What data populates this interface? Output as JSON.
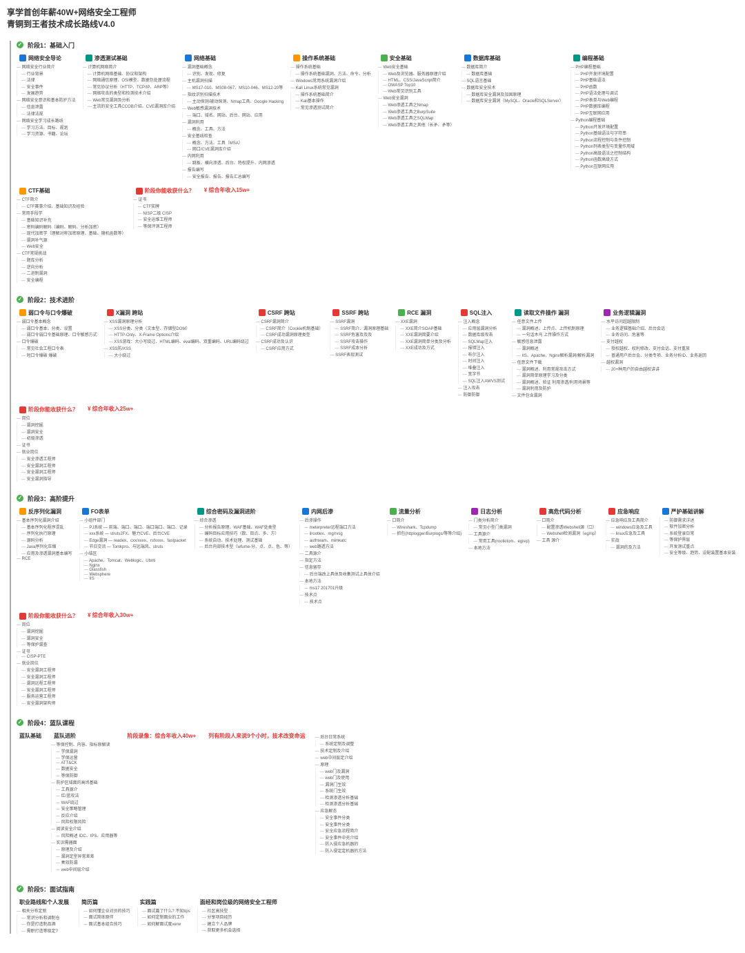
{
  "header": {
    "line1": "享学首创年薪40W+网络安全工程师",
    "line2": "青铜到王者技术成长路线V4.0"
  },
  "stages": [
    {
      "id": "s1",
      "label": "阶段1：基础入门",
      "sections": [
        {
          "icon": "ic-blue",
          "label": "网络安全导论",
          "items": [
            {
              "k": "网络安全行业简介",
              "sub": [
                "行业背景",
                "法律",
                "安全事件",
                "发展趋势"
              ]
            },
            {
              "k": "网络安全意识和基本防护方法",
              "sub": [
                "信息泄露",
                "法律法规"
              ]
            },
            {
              "k": "网络安全学习成长路线",
              "sub": [
                "学习方法、目标、规划",
                "学习资源、书籍、论坛"
              ]
            }
          ]
        },
        {
          "icon": "ic-teal",
          "label": "渗透测试基础",
          "items": [
            {
              "k": "计算机网络简介",
              "sub": [
                "计算机网络基础、协议和架构",
                "网络通信原理、OSI模型、数据包处理流程",
                "常见协议分析（HTTP、TCP/IP、ARP等）",
                "网络攻击的类型和检测技术介绍",
                "Web常见漏洞及分析",
                "主流的安全工具CCOB介绍、CVE漏洞库介绍"
              ]
            }
          ]
        },
        {
          "icon": "ic-blue",
          "label": "网络基础",
          "items": [
            {
              "k": "漏洞基础概念",
              "sub": [
                "识别、发现、修复"
              ]
            },
            {
              "k": "主机漏洞扫描",
              "sub": [
                "MS17-010、MS08-067、MS10-046、MS12-20等"
              ]
            },
            {
              "k": "指纹识别扫描技术",
              "sub": [
                "主动探测/被动探测、Nmap工具、Google Hacking"
              ]
            },
            {
              "k": "Web敏感漏洞技术",
              "sub": [
                "端口、域名、网站、后台、网站、应用"
              ]
            },
            {
              "k": "漏洞利用",
              "sub": [
                "概念、工具、方法"
              ]
            },
            {
              "k": "安全基线检查",
              "sub": [
                "概念、方法、工具（MSA）",
                "网口/CVE漏洞库介绍"
              ]
            },
            {
              "k": "内网利用",
              "sub": [
                "跳板、横向渗透、后台、特权提升、内网渗透"
              ]
            },
            {
              "k": "报告编写",
              "sub": [
                "安全报告、报告、报告汇总编写"
              ]
            }
          ]
        },
        {
          "icon": "ic-orange",
          "label": "操作系统基础",
          "items": [
            {
              "k": "操作系统基础",
              "sub": [
                "操作系统基础漏洞、方法、命令、分析"
              ]
            },
            {
              "k": "Windows常用系统漏洞介绍"
            },
            {
              "k": "Kali Linux系统常见漏洞",
              "sub": [
                "操作系统基础简介",
                "Kali基本操作",
                "常见渗透测试简介"
              ]
            }
          ]
        },
        {
          "icon": "ic-green",
          "label": "安全基础",
          "items": [
            {
              "k": "Web安全基础",
              "sub": [
                "Web及浏览器、服务器原理介绍",
                "HTML、CSS/JavaScript简介",
                "OWASP Top10",
                "Web常见识别工具"
              ]
            },
            {
              "k": "Web安全漏洞",
              "sub": [
                "Web渗透工具之Nmap",
                "Web渗透工具之BurpSuite",
                "Web渗透工具之SQLMap",
                "Web渗透工具之其他（长矛、矛等）"
              ]
            }
          ]
        },
        {
          "icon": "ic-blue",
          "label": "数据库基础",
          "items": [
            {
              "k": "数据库简介",
              "sub": [
                "数据库基础"
              ]
            },
            {
              "k": "SQL语言基础"
            },
            {
              "k": "数据库安全技术",
              "sub": [
                "数据库安全漏洞及加固原理",
                "数据库安全漏洞（MySQL、Oracle和SQLServer）"
              ]
            }
          ]
        },
        {
          "icon": "ic-teal",
          "label": "编程基础",
          "items": [
            {
              "k": "PHP编程基础",
              "sub": [
                "PHP开发环境配置",
                "PHP基础语法",
                "PHP函数",
                "PHP语法处理与调试",
                "PHP表单与Web编程",
                "PHP数据库编程",
                "PHP互联网应用"
              ]
            },
            {
              "k": "Python编程基础",
              "sub": [
                "Python开发环境配置",
                "Python基础语法与字符串",
                "Python流程控制与条件控制",
                "Python列表类型与变量作用域",
                "Python高级语法之控制结构",
                "Python函数高级方式",
                "Python互联网应用"
              ]
            }
          ]
        },
        {
          "icon": "ic-orange",
          "label": "CTF基础",
          "items": [
            {
              "k": "CTF简介",
              "sub": [
                "CTF赛事介绍、基础知识及经验"
              ]
            },
            {
              "k": "常用手段学",
              "sub": [
                "基础知识补充",
                "密码编码解码（编码、解码、分析加密）",
                "现代加密学（理解对称加密原理、基础、随机函数等）",
                "漏洞补气源",
                "Web安全"
              ]
            },
            {
              "k": "CTF常规挑战",
              "sub": [
                "题库分析",
                "逆向分析",
                "二进制漏洞",
                "安全编程"
              ]
            }
          ]
        },
        {
          "icon": "ic-red",
          "label": "阶段你能收获什么？",
          "red": true,
          "items": [
            {
              "k": "证书",
              "sub": [
                "CTF奖牌",
                "NISP二级 CISP",
                "安全运维工程师",
                "等保评测工程师"
              ]
            }
          ]
        },
        {
          "income": "综合年收入15w+"
        }
      ]
    },
    {
      "id": "s2",
      "label": "阶段2：技术进阶",
      "sections": [
        {
          "icon": "ic-orange",
          "label": "弱口令与口令爆破",
          "items": [
            {
              "k": "弱口令基本概念",
              "sub": [
                "弱口令基本、分类、设置",
                "弱口令弱口令基础原理、口令敏感方式"
              ]
            },
            {
              "k": "口令爆破",
              "sub": [
                "常见社会工程口令表",
                "短口令爆破 爆破"
              ]
            }
          ]
        },
        {
          "icon": "ic-red",
          "label": "X漏洞 跨站",
          "items": [
            {
              "k": "XSS漏洞原理分析",
              "sub": [
                "XSS分类、分类（文本型、存储型DOM）",
                "HTTP-Only、X-Frame Options介绍",
                "XSS游戏：大小写绕过、HTML编码、eval编码、双重编码、URL编码绕过"
              ]
            },
            {
              "k": "XSS防/XSS",
              "sub": [
                "大小绕过"
              ]
            }
          ]
        },
        {
          "icon": "ic-red",
          "label": "CSRF 跨站",
          "items": [
            {
              "k": "CSRF漏洞简介",
              "sub": [
                "CSRF简介（Cookie机制基础）",
                "CSRF成功漏洞原理类型"
              ]
            },
            {
              "k": "CSRF成功及认识",
              "sub": [
                "CSRF应用方式"
              ]
            }
          ]
        },
        {
          "icon": "ic-red",
          "label": "SSRF 跨站",
          "items": [
            {
              "k": "SSRF漏洞",
              "sub": [
                "SSRF简介、漏洞原理基础",
                "SSRF危害及及及",
                "SSRF攻击操作",
                "SSRF成本分析"
              ]
            },
            {
              "k": "SSRF表现测试"
            }
          ]
        },
        {
          "icon": "ic-green",
          "label": "RCE 漏洞",
          "items": [
            {
              "k": "XXE漏洞",
              "sub": [
                "XXE简介SOAP基础",
                "XXE漏洞简要介绍",
                "XXE漏洞简单分类及分析",
                "XXE成功及方式"
              ]
            }
          ]
        },
        {
          "icon": "ic-red",
          "label": "SQL注入",
          "items": [
            {
              "k": "注入概念",
              "sub": [
                "应用层漏洞分析",
                "数据库级攻击",
                "SQLMap注入",
                "报错注入",
                "布尔注入",
                "时间注入",
                "堆叠注入",
                "宽字节",
                "SQL注入AWVS测试"
              ]
            },
            {
              "k": "注入攻击"
            },
            {
              "k": "防御防御"
            }
          ]
        },
        {
          "icon": "ic-teal",
          "label": "读取文件操作 漏洞",
          "items": [
            {
              "k": "任意文件上传",
              "sub": [
                "漏洞概述、上传点、上传机制原理",
                "一句话木马 上传操作方式"
              ]
            },
            {
              "k": "敏感信息泄露",
              "sub": [
                "漏洞概述",
                "IIS、Apache、Nginx解析漏洞/解析漏洞"
              ]
            },
            {
              "k": "任意文件下载",
              "sub": [
                "漏洞概述、利用常规攻击方式",
                "漏洞简单原理学习及分类",
                "漏洞概述、验证 利用渗透/利用场景等",
                "漏洞利用及防护"
              ]
            },
            {
              "k": "文件包含漏洞"
            }
          ]
        },
        {
          "icon": "ic-purple",
          "label": "业务逻辑漏洞",
          "items": [
            {
              "k": "水平访问超越限制",
              "sub": [
                "业务逻辑基础介绍、后台会话",
                "业务访问、危害等"
              ]
            },
            {
              "k": "支付越权",
              "sub": [
                "授权越权、权利修改、支付会话、支付重放",
                "普通用户后台会、分类专项、业务分析ID、业务返回"
              ]
            },
            {
              "k": "越权漏洞",
              "sub": [
                "20+种用户的自由越权讲讲"
              ]
            }
          ]
        },
        {
          "icon": "ic-red",
          "label": "阶段你能收获什么？",
          "red": true,
          "items": [
            {
              "k": "岗位",
              "sub": [
                "漏洞挖掘",
                "漏洞安全",
                "初级渗透"
              ]
            },
            {
              "k": "证书"
            },
            {
              "k": "就业岗位",
              "sub": [
                "安全渗透工程师",
                "安全漏洞工程师",
                "安全漏洞工程师",
                "安全漏洞指导"
              ]
            }
          ]
        },
        {
          "income": "综合年收入25w+"
        }
      ]
    },
    {
      "id": "s3",
      "label": "阶段3：高阶提升",
      "sections": [
        {
          "icon": "ic-orange",
          "label": "反序列化漏洞",
          "items": [
            {
              "k": "基本序列化漏洞介绍",
              "sub": [
                "基本序列化程序混乱",
                "序列化执行原理",
                "源码分析",
                "Java序列化压缩",
                "应用及渗透漏洞基本编写"
              ]
            },
            {
              "k": "RCE"
            }
          ]
        },
        {
          "icon": "ic-blue",
          "label": "FO表单",
          "items": [
            {
              "k": "小组件部门",
              "sub": [
                "PJ系统 — 前端、端口、端口、端口端口、端口、记录",
                "xxx系统 — struts2FX、魅力CVE、后台CVE",
                "Edge漏洞 — readex、cxx/xxxx、rsfxxxx、fastpacket",
                "节日交流 — Tomkpro、与远端风、struts"
              ]
            },
            {
              "k": "小结区",
              "sub": [
                "Apache、Tomcat、Weblogic、Ubnti",
                "Nginx",
                "Glassfish",
                "Websphere",
                "IIS"
              ]
            }
          ]
        },
        {
          "icon": "ic-teal",
          "label": "综合密码及漏洞进阶",
          "items": [
            {
              "k": "综合渗透",
              "sub": [
                "分析报告原理、WAF基础、WAF处类型",
                "编码目标应用技巧（数、目点、多、方）",
                "系统自动、技术处理、测试基础",
                "后台内部技术型（wfume-分、点、点、色、等）"
              ]
            }
          ]
        },
        {
          "icon": "ic-blue",
          "label": "内网后渗",
          "items": [
            {
              "k": "后渗操作",
              "sub": [
                "meterpreter远程端口方法",
                "ilrootlex、mg/rvsg",
                "authteam、mimkatc",
                "web路透方法"
              ]
            },
            {
              "k": "二具源介",
              "sub": []
            },
            {
              "k": "指定方法"
            },
            {
              "k": "信息留存",
              "sub": [
                "后台端改上具体及收集测试上具体介绍"
              ]
            },
            {
              "k": "本地方法",
              "sub": [
                "ms17 201701升级"
              ]
            },
            {
              "k": "技术点",
              "sub": [
                "技术点"
              ]
            }
          ]
        },
        {
          "icon": "ic-green",
          "label": "流量分析",
          "items": [
            {
              "k": "口简介",
              "sub": [
                "Wireshark、Tcpdump",
                "抓包(httplogger/Burplogs/等等介绍)"
              ]
            }
          ]
        },
        {
          "icon": "ic-purple",
          "label": "日志分析",
          "items": [
            {
              "k": "门类分析简介",
              "sub": [
                "常见小型门类漏洞"
              ]
            },
            {
              "k": "工具源介",
              "sub": [
                "常用工具(rootkitom、egrep)"
              ]
            },
            {
              "k": "本地方法"
            }
          ]
        },
        {
          "icon": "ic-red",
          "label": "高危代码分析",
          "items": [
            {
              "k": "口简介",
              "sub": [
                "配置渗透Webshell源（口）",
                "Webshell检测漏洞（eg/rip）"
              ]
            },
            {
              "k": "工具 源介"
            }
          ]
        },
        {
          "icon": "ic-red",
          "label": "应急响应",
          "items": [
            {
              "k": "应急响应及工具简介",
              "sub": [
                "windows应急及工具",
                "linux应急及工具"
              ]
            },
            {
              "k": "实战",
              "sub": [
                "漏洞的及方法"
              ]
            }
          ]
        },
        {
          "icon": "ic-blue",
          "label": "严护基础讲解",
          "items": [
            {
              "k": "",
              "sub": [
                "防御需求详述",
                "软件加密分析",
                "系统登录日常",
                "等保护界层",
                "开发测试重点",
                "安全等级、趋势、设配装置基本安装"
              ]
            }
          ]
        },
        {
          "icon": "ic-red",
          "label": "阶段你能收获什么？",
          "red": true,
          "items": [
            {
              "k": "岗位",
              "sub": [
                "漏洞挖掘",
                "漏洞安全",
                "等保护漏查"
              ]
            },
            {
              "k": "证书",
              "sub": [
                "CISP-PTE"
              ]
            },
            {
              "k": "就业岗位",
              "sub": [
                "安全漏洞工程师",
                "安全漏洞工程师",
                "漏洞远程工程师",
                "安全漏洞工程师",
                "服务运营工程师",
                "安全漏洞架构师"
              ]
            }
          ]
        },
        {
          "income": "综合年收入30w+"
        }
      ]
    },
    {
      "id": "s4",
      "label": "阶段4：蓝队课程",
      "sections": [
        {
          "icon": "",
          "label": "蓝队基础",
          "simple": true
        },
        {
          "icon": "",
          "label": "蓝队进阶",
          "items": [
            {
              "k": "等保控制、内容、指标原解读",
              "sub": [
                "学保漏洞",
                "学保运营",
                "ATT&CK",
                "数据安全",
                "等保防御"
              ]
            },
            {
              "k": "防护区域面的高纬基础",
              "sub": [
                "工具源介",
                "红/蓝攻法",
                "WAF绕过",
                "安全策略管理",
                "反应介绍",
                "风险权限风险"
              ]
            },
            {
              "k": "阅读安全介绍",
              "sub": [
                "风险概述 IDC、IPS、应用器等"
              ]
            },
            {
              "k": "实训需器面",
              "sub": [
                "原理及介绍",
                "漏洞定型异常差差",
                "奏效防漏",
                "web中间层介绍"
              ]
            }
          ]
        },
        {
          "icon": "",
          "label": "阶段录像：综合年收入40w+",
          "red": true,
          "simple": true
        },
        {
          "icon": "",
          "label": "列有阶段人来说9个小时，技术改变命运",
          "red": true,
          "simple": true
        },
        {
          "icon": "",
          "label": "",
          "items": [
            {
              "k": "后台日常系统",
              "sub": [
                "系统定制及调整"
              ]
            },
            {
              "k": "技术定制及介绍"
            },
            {
              "k": "web中间层定介绍"
            },
            {
              "k": "原理",
              "sub": [
                "web门及漏洞",
                "web门及使用",
                "漏洞门生效",
                "系统门生效",
                "检测渗透分析基础",
                "检测渗透分析基础"
              ]
            },
            {
              "k": "应急解态",
              "sub": [
                "安全事件分类",
                "安全事件分类",
                "安全应急流程简介",
                "安全事件中充介绍",
                "防入侵应急机器的",
                "防入侵定定机器的方法"
              ]
            }
          ]
        }
      ]
    },
    {
      "id": "s5",
      "label": "阶段5：面试指南",
      "sections": [
        {
          "icon": "",
          "label": "职业路线和个人发展",
          "items": [
            {
              "k": "相关分布定新",
              "sub": [
                "常识分析和调制仓",
                "你是打造制品酒",
                "需职打造等级定?"
              ]
            }
          ]
        },
        {
          "icon": "",
          "label": "简历篇",
          "items": [
            {
              "k": "",
              "sub": [
                "如何懂企业对员的技巧",
                "面试简练原伴",
                "面试基本组合技巧"
              ]
            }
          ]
        },
        {
          "icon": "",
          "label": "实践篇",
          "items": [
            {
              "k": "",
              "sub": [
                "面试篇了什么? 不知tips",
                "如何定制面业的工作",
                "如何解面试度verw"
              ]
            }
          ]
        },
        {
          "icon": "",
          "label": "面经和岗位级的网络安全工程师",
          "items": [
            {
              "k": "",
              "sub": [
                "社区高技型",
                "分享项目经历",
                "建立个人品牌",
                "获取更多机会选择"
              ]
            }
          ]
        }
      ]
    }
  ]
}
